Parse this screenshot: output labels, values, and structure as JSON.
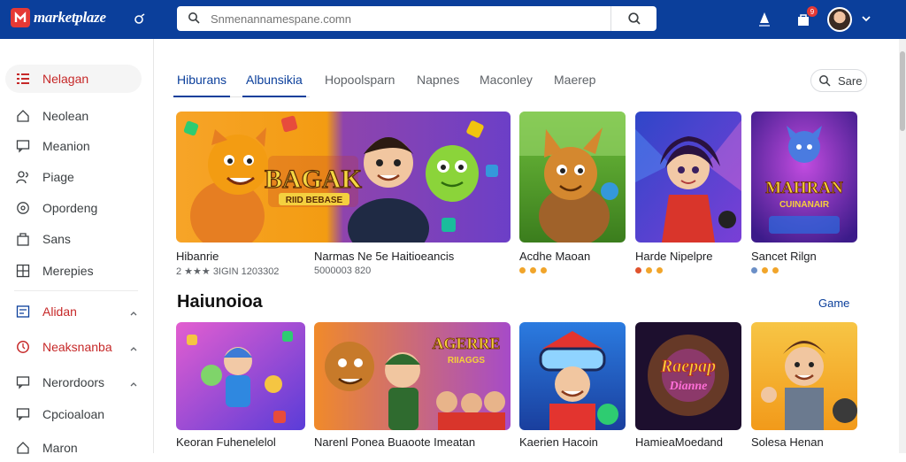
{
  "header": {
    "brand": "marketplaze",
    "search_placeholder": "Snmenannamespane.comn",
    "notif_count": "9"
  },
  "sidebar": {
    "items": [
      {
        "label": "Nelagan"
      },
      {
        "label": "Neolean"
      },
      {
        "label": "Meanion"
      },
      {
        "label": "Piage"
      },
      {
        "label": "Opordeng"
      },
      {
        "label": "Sans"
      },
      {
        "label": "Merepies"
      },
      {
        "label": "Alidan"
      },
      {
        "label": "Neaksnanba"
      },
      {
        "label": "Nerordoors"
      },
      {
        "label": "Cpcioaloan"
      },
      {
        "label": "Maron"
      }
    ]
  },
  "tabs": [
    {
      "label": "Hiburans"
    },
    {
      "label": "Albunsikia"
    },
    {
      "label": "Hopoolsparn"
    },
    {
      "label": "Napnes"
    },
    {
      "label": "Maconley"
    },
    {
      "label": "Maerep"
    }
  ],
  "sort_label": "Sare",
  "row1": [
    {
      "title": "Hibanrie",
      "meta": "2 ★★★ 3IGIN 1203302",
      "poster": "BAGAK",
      "poster_sub": "RIID BEBASE"
    },
    {
      "title": "Narmas Ne 5e Haitioeancis",
      "meta": "5000003 820"
    },
    {
      "title": "Acdhe Maoan",
      "meta": ""
    },
    {
      "title": "Harde Nipelpre",
      "meta": ""
    },
    {
      "title": "Sancet Rilgn",
      "meta": "",
      "poster": "MAHRAN",
      "poster_sub": "CUINANAIR"
    }
  ],
  "section": {
    "title": "Haiunoioa",
    "link": "Game"
  },
  "row2": [
    {
      "title": "Keoran Fuhenelelol"
    },
    {
      "title": "Narenl Ponea Buaoote Imeatan",
      "poster": "AGERRE",
      "poster_sub": "RIIAGGS"
    },
    {
      "title": "Kaerien Hacoin"
    },
    {
      "title": "HamieaMoedand",
      "poster": "Raepap",
      "poster_sub": "Dianne"
    },
    {
      "title": "Solesa Henan"
    }
  ],
  "colors": {
    "header_bg": "#0b3f9b",
    "accent_red": "#c62828",
    "link_blue": "#0b3f9b"
  }
}
